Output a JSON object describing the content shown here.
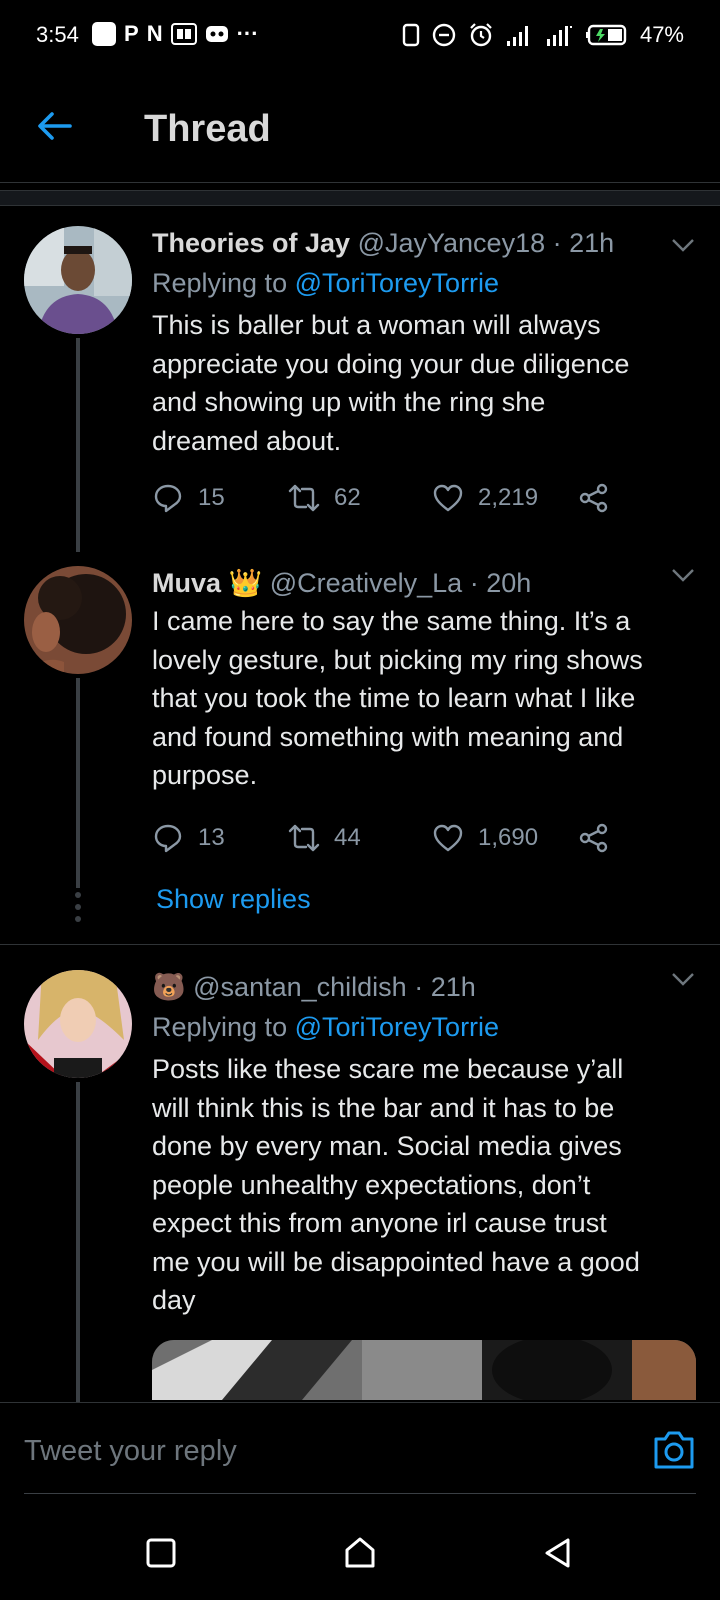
{
  "status_bar": {
    "time": "3:54",
    "left_glyphs": [
      "P",
      "N"
    ],
    "more": "···",
    "battery": "47%"
  },
  "header": {
    "title": "Thread"
  },
  "tweets": [
    {
      "display_name": "Theories of Jay",
      "handle": "@JayYancey18",
      "time": "21h",
      "replying_prefix": "Replying to",
      "replying_to": "@ToriToreyTorrie",
      "text_lines": [
        "This is baller but a woman will always",
        "appreciate you doing your due diligence",
        "and showing up with the ring she",
        "dreamed about."
      ],
      "replies": "15",
      "retweets": "62",
      "likes": "2,219"
    },
    {
      "display_name": "Muva",
      "display_emoji": "👑",
      "handle": "@Creatively_La",
      "time": "20h",
      "text_lines": [
        "I came here to say the same thing. It’s a",
        "lovely gesture, but picking my ring shows",
        "that you took the time to learn what I like",
        "and found something with meaning and",
        "purpose."
      ],
      "replies": "13",
      "retweets": "44",
      "likes": "1,690",
      "show_replies": "Show replies"
    },
    {
      "display_emoji": "🐻",
      "handle": "@santan_childish",
      "time": "21h",
      "replying_prefix": "Replying to",
      "replying_to": "@ToriToreyTorrie",
      "text_lines": [
        "Posts like these scare me because y’all",
        "will think this is the bar and it has to be",
        "done by every man. Social media gives",
        "people unhealthy expectations, don’t",
        "expect this from anyone irl cause trust",
        "me you will be disappointed have a good",
        "day"
      ]
    }
  ],
  "reply_bar": {
    "placeholder": "Tweet your reply"
  },
  "colors": {
    "background": "#000000",
    "accent": "#1d9bf0",
    "secondary_text": "#8b98a5",
    "primary_text": "#e7e9ea"
  },
  "icons": [
    "back-arrow-icon",
    "chevron-down-icon",
    "reply-icon",
    "retweet-icon",
    "like-icon",
    "share-icon",
    "camera-icon",
    "nav-square-icon",
    "nav-home-icon",
    "nav-back-icon"
  ]
}
